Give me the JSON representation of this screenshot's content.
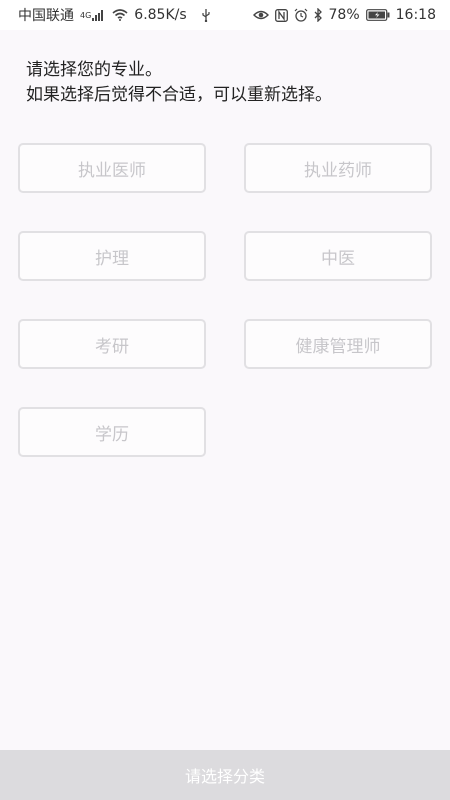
{
  "status_bar": {
    "carrier": "中国联通",
    "network": "4G",
    "speed": "6.85K/s",
    "battery": "78%",
    "time": "16:18"
  },
  "intro": {
    "line1": "请选择您的专业。",
    "line2": "如果选择后觉得不合适，可以重新选择。"
  },
  "options": [
    {
      "label": "执业医师"
    },
    {
      "label": "执业药师"
    },
    {
      "label": "护理"
    },
    {
      "label": "中医"
    },
    {
      "label": "考研"
    },
    {
      "label": "健康管理师"
    },
    {
      "label": "学历"
    }
  ],
  "bottom": {
    "label": "请选择分类"
  },
  "colors": {
    "background": "#faf8fb",
    "option_border": "#e1e0e3",
    "option_text": "#c7c6ca",
    "bottom_bar": "#dcdbde"
  }
}
